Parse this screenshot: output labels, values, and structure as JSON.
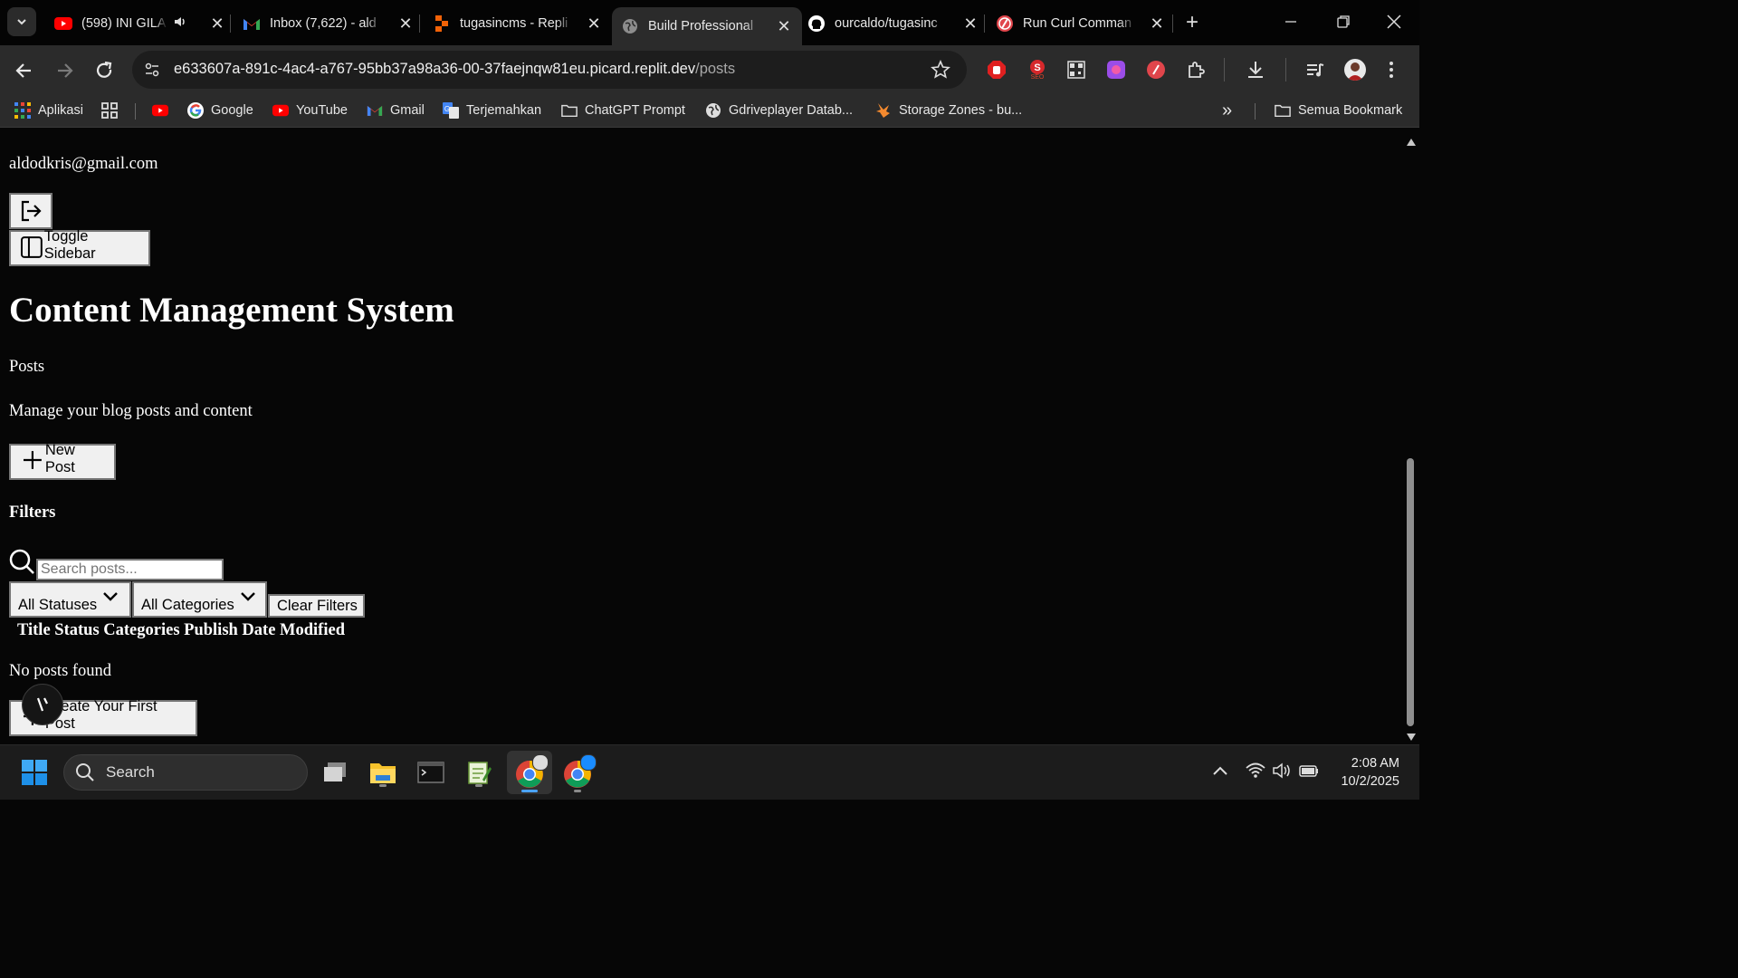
{
  "browser": {
    "tabs": [
      {
        "title": "(598) INI GILA I",
        "icon": "youtube-icon"
      },
      {
        "title": "Inbox (7,622) - ald",
        "icon": "gmail-icon"
      },
      {
        "title": "tugasincms - Repli",
        "icon": "replit-icon"
      },
      {
        "title": "Build Professional",
        "icon": "globe-icon",
        "active": true
      },
      {
        "title": "ourcaldo/tugasinc",
        "icon": "github-icon"
      },
      {
        "title": "Run Curl Comman",
        "icon": "curl-icon"
      }
    ],
    "new_tab": "+",
    "url_host": "e633607a-891c-4ac4-a767-95bb37a98a36-00-37faejnqw81eu.picard.replit.dev",
    "url_path": "/posts",
    "bookmarks": [
      {
        "label": "Aplikasi",
        "icon": "apps-grid-icon"
      },
      {
        "label": "",
        "icon": "grid-icon"
      },
      {
        "label": "",
        "icon": "youtube-icon"
      },
      {
        "label": "Google",
        "icon": "google-icon"
      },
      {
        "label": "YouTube",
        "icon": "youtube-icon"
      },
      {
        "label": "Gmail",
        "icon": "gmail-icon"
      },
      {
        "label": "Terjemahkan",
        "icon": "translate-icon"
      },
      {
        "label": "ChatGPT Prompt",
        "icon": "folder-icon"
      },
      {
        "label": "Gdriveplayer Datab...",
        "icon": "globe-icon"
      },
      {
        "label": "Storage Zones - bu...",
        "icon": "bunny-icon"
      }
    ],
    "all_bookmarks": "Semua Bookmark",
    "overflow": "»"
  },
  "page": {
    "email": "aldodkris@gmail.com",
    "toggle_sidebar": "Toggle Sidebar",
    "heading": "Content Management System",
    "section": "Posts",
    "description": "Manage your blog posts and content",
    "new_post": "New Post",
    "filters_heading": "Filters",
    "search_placeholder": "Search posts...",
    "status_select": "All Statuses",
    "category_select": "All Categories",
    "clear_filters": "Clear Filters",
    "table_headers": [
      "Title",
      "Status",
      "Categories",
      "Publish Date",
      "Modified"
    ],
    "empty_text": "No posts found",
    "create_first": "Create Your First Post"
  },
  "taskbar": {
    "search_label": "Search",
    "time": "2:08 AM",
    "date": "10/2/2025"
  },
  "colors": {
    "tab_bar": "#040404",
    "toolbar": "#2b2b2b",
    "page_bg": "#060606",
    "taskbar": "#1c1c1c"
  }
}
